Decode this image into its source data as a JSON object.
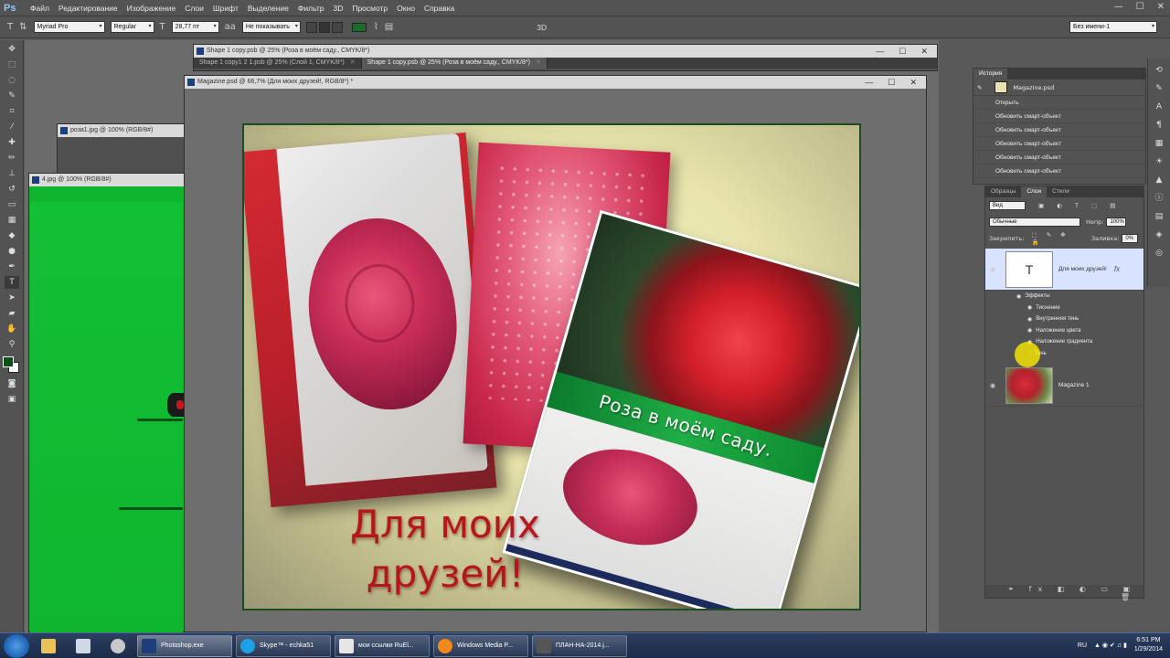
{
  "menubar": {
    "logo": "Ps",
    "items": [
      "Файл",
      "Редактирование",
      "Изображение",
      "Слои",
      "Шрифт",
      "Выделение",
      "Фильтр",
      "3D",
      "Просмотр",
      "Окно",
      "Справка"
    ],
    "controls": [
      "—",
      "☐",
      "✕"
    ]
  },
  "options": {
    "font_family": "Myriad Pro",
    "font_style": "Regular",
    "font_size": "28,77 пт",
    "aa_label": "aa",
    "aa_mode": "Не показывать",
    "mode_3d": "3D",
    "workspace": "Без имени-1",
    "text_color": "#1d6b2a"
  },
  "tools": [
    "move-icon",
    "marquee-icon",
    "lasso-icon",
    "quick-select-icon",
    "crop-icon",
    "eyedropper-icon",
    "healing-icon",
    "brush-icon",
    "stamp-icon",
    "history-brush-icon",
    "eraser-icon",
    "gradient-icon",
    "blur-icon",
    "dodge-icon",
    "pen-icon",
    "type-icon",
    "path-select-icon",
    "shape-icon",
    "hand-icon",
    "zoom-icon"
  ],
  "documents": {
    "shape_copy": "Shape 1 copy.psb @ 25% (Роза в моём саду., CMYK/8*)",
    "tab1": "Shape 1 copy1 2 1.psb @ 25% (Слой 1, CMYK/8*)",
    "tab2": "Shape 1 copy.psb @ 25% (Роза в моём саду., CMYK/8*)",
    "magazine": "Magazine.psd @ 66,7% (Для моих  друзей!, RGB/8*) *",
    "rose1": "роза1.jpg @ 100% (RGB/8#)",
    "jpg4": "4.jpg @ 100% (RGB/8#)"
  },
  "artwork": {
    "cover_title": "Роза в моём саду.",
    "headline_line1": "Для моих",
    "headline_line2": "друзей!"
  },
  "history": {
    "tab": "История",
    "snapshot": "Magazine.psd",
    "rows": [
      "Открыть",
      "Обновить смарт-объект",
      "Обновить смарт-объект",
      "Обновить смарт-объект",
      "Обновить смарт-объект",
      "Обновить смарт-объект"
    ]
  },
  "layers": {
    "tabs": [
      "Образцы",
      "Слои",
      "Стили"
    ],
    "filter": "Вид",
    "blend_mode": "Обычные",
    "opacity_label": "Непр:",
    "opacity": "100%",
    "lock_label": "Закрепить:",
    "fill_label": "Заливка:",
    "fill": "0%",
    "text_layer": "Для моих  друзей!",
    "fx": "fx",
    "effects_label": "Эффекты",
    "effects": [
      "Тиснение",
      "Внутренняя тень",
      "Наложение цвета",
      "Наложение градиента",
      "Тень"
    ],
    "image_layer": "Magazine 1"
  },
  "taskbar": {
    "buttons": [
      "Photoshop.exe",
      "Skype™ - echka51",
      "мои ссылки RuEl...",
      "Windows Media P...",
      "ПЛАН-НА-2014.j..."
    ],
    "lang": "RU",
    "time": "6:51 PM",
    "date": "1/29/2014"
  }
}
